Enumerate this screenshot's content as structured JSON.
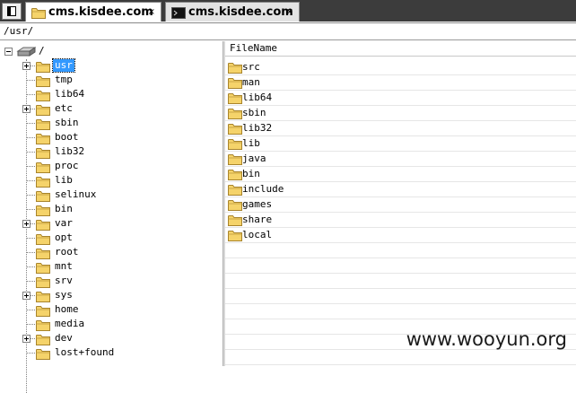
{
  "tabs": [
    {
      "label": "cms.kisdee.com",
      "close": "×"
    },
    {
      "label": "cms.kisdee.com",
      "close": "×"
    }
  ],
  "path": "/usr/",
  "tree": {
    "root_label": "/",
    "items": [
      {
        "label": "usr",
        "expandable": true,
        "selected": true
      },
      {
        "label": "tmp",
        "expandable": false
      },
      {
        "label": "lib64",
        "expandable": false
      },
      {
        "label": "etc",
        "expandable": true
      },
      {
        "label": "sbin",
        "expandable": false
      },
      {
        "label": "boot",
        "expandable": false
      },
      {
        "label": "lib32",
        "expandable": false
      },
      {
        "label": "proc",
        "expandable": false
      },
      {
        "label": "lib",
        "expandable": false
      },
      {
        "label": "selinux",
        "expandable": false
      },
      {
        "label": "bin",
        "expandable": false
      },
      {
        "label": "var",
        "expandable": true
      },
      {
        "label": "opt",
        "expandable": false
      },
      {
        "label": "root",
        "expandable": false
      },
      {
        "label": "mnt",
        "expandable": false
      },
      {
        "label": "srv",
        "expandable": false
      },
      {
        "label": "sys",
        "expandable": true
      },
      {
        "label": "home",
        "expandable": false
      },
      {
        "label": "media",
        "expandable": false
      },
      {
        "label": "dev",
        "expandable": true
      },
      {
        "label": "lost+found",
        "expandable": false
      }
    ]
  },
  "files": {
    "header": "FileName",
    "items": [
      "src",
      "man",
      "lib64",
      "sbin",
      "lib32",
      "lib",
      "java",
      "bin",
      "include",
      "games",
      "share",
      "local"
    ]
  },
  "watermark": "www.wooyun.org"
}
